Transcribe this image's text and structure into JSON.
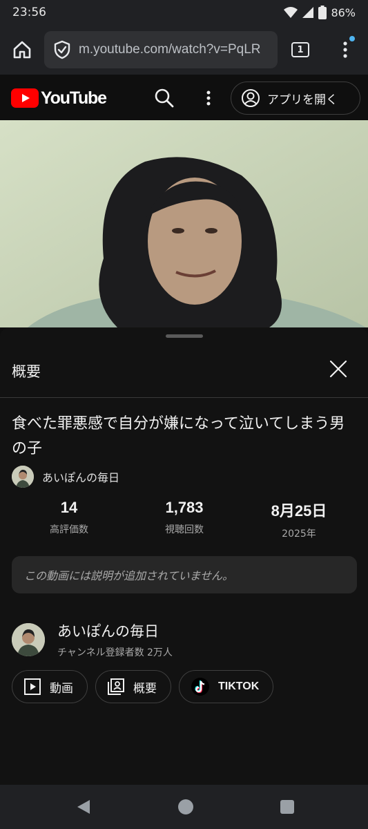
{
  "status_bar": {
    "time": "23:56",
    "battery": "86%"
  },
  "browser": {
    "url": "m.youtube.com/watch?v=PqLR",
    "tab_count": "1"
  },
  "yt_header": {
    "logo_text": "YouTube",
    "open_app_label": "アプリを開く"
  },
  "sheet": {
    "title": "概要",
    "video_title": "食べた罪悪感で自分が嫌になって泣いてしまう男の子",
    "channel_name": "あいぽんの毎日",
    "stats": [
      {
        "value": "14",
        "label": "高評価数"
      },
      {
        "value": "1,783",
        "label": "視聴回数"
      },
      {
        "value": "8月25日",
        "label": "2025年"
      }
    ],
    "no_description": "この動画には説明が追加されていません。",
    "channel": {
      "name": "あいぽんの毎日",
      "subscribers": "チャンネル登録者数 2万人"
    },
    "chips": [
      {
        "label": "動画",
        "icon": "video-icon"
      },
      {
        "label": "概要",
        "icon": "about-icon"
      },
      {
        "label": "TIKTOK",
        "icon": "tiktok-icon"
      }
    ]
  },
  "colors": {
    "yt_red": "#ff0000",
    "background": "#0f0f0f",
    "sheet": "#121212",
    "chip_border": "#3f3f3f"
  }
}
